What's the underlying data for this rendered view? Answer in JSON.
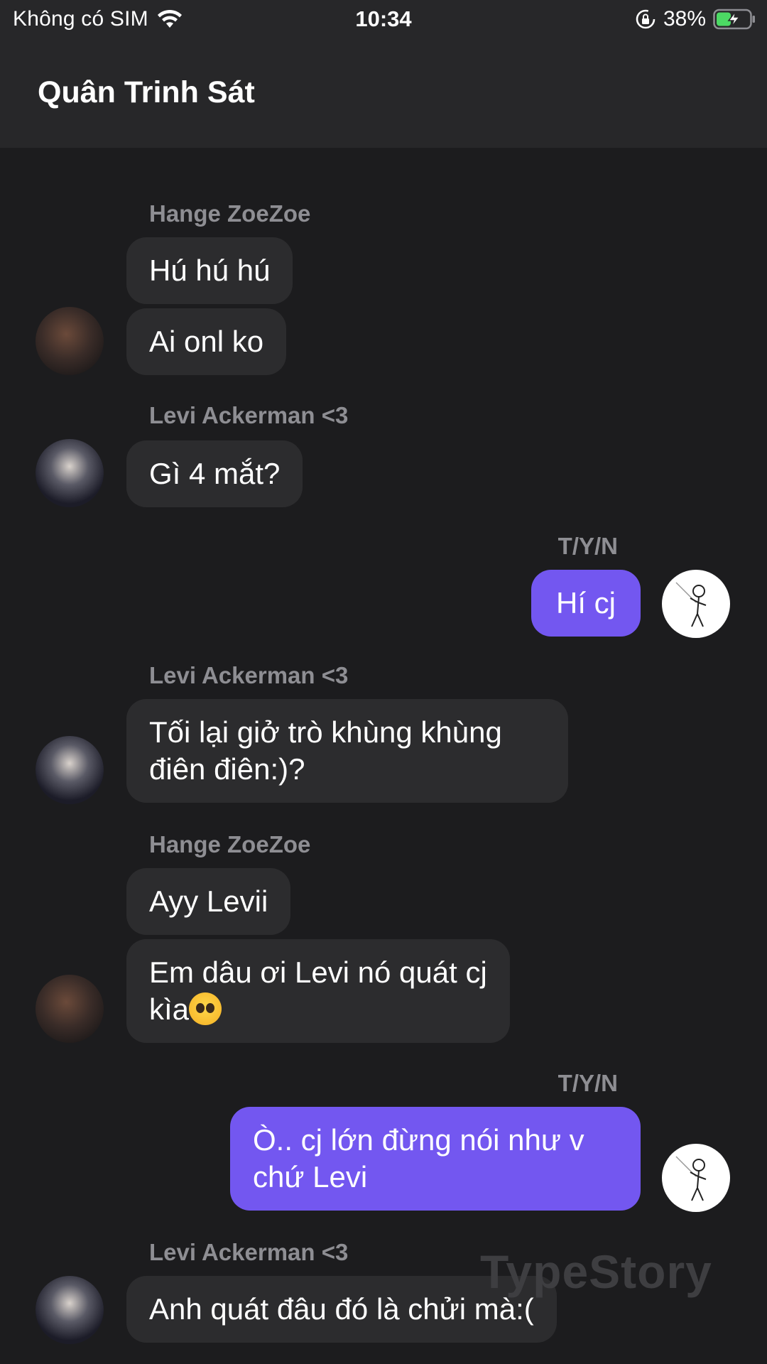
{
  "status_bar": {
    "carrier": "Không có SIM",
    "time": "10:34",
    "battery_percent": "38%",
    "icons": [
      "wifi-icon",
      "rotation-lock-icon",
      "battery-charging-icon"
    ]
  },
  "header": {
    "title": "Quân Trinh Sát"
  },
  "messages": [
    {
      "sender": "Hange ZoeZoe",
      "mine": false,
      "texts": [
        "Hú hú hú",
        "Ai onl ko"
      ]
    },
    {
      "sender": "Levi Ackerman <3",
      "mine": false,
      "texts": [
        "Gì 4 mắt?"
      ]
    },
    {
      "sender": "T/Y/N",
      "mine": true,
      "texts": [
        "Hí cj"
      ]
    },
    {
      "sender": "Levi Ackerman <3",
      "mine": false,
      "texts": [
        "Tối lại giở trò khùng khùng điên điên:)?"
      ]
    },
    {
      "sender": "Hange ZoeZoe",
      "mine": false,
      "texts": [
        "Ayy Levii",
        "Em dâu ơi Levi nó quát cj kìa"
      ]
    },
    {
      "sender": "T/Y/N",
      "mine": true,
      "texts": [
        "Ò.. cj lớn đừng nói như v chứ Levi"
      ]
    },
    {
      "sender": "Levi Ackerman <3",
      "mine": false,
      "texts": [
        "Anh quát đâu đó là chửi mà:("
      ]
    }
  ],
  "watermark": "TypeStory",
  "colors": {
    "background": "#1c1c1e",
    "header_bg": "#272729",
    "incoming_bubble": "#2c2c2e",
    "outgoing_bubble": "#7357f0",
    "sender_name": "#8e8e93"
  }
}
